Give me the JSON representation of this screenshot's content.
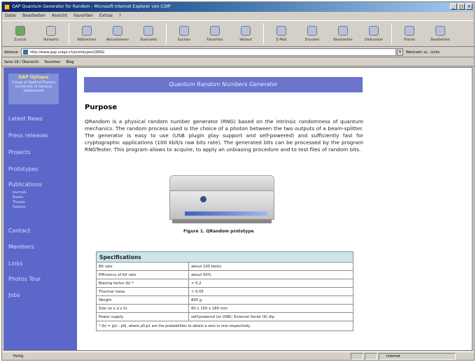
{
  "window": {
    "title": "QAP Quantum Generator for Random - Microsoft Internet Explorer von COIP"
  },
  "menu": [
    "Datei",
    "Bearbeiten",
    "Ansicht",
    "Favoriten",
    "Extras",
    "?"
  ],
  "toolbar": [
    {
      "label": "Zurück",
      "icon": "back-arrow-icon"
    },
    {
      "label": "Vorwärts",
      "icon": "forward-arrow-icon"
    },
    {
      "label": "Abbrechen",
      "icon": "stop-icon"
    },
    {
      "label": "Aktualisieren",
      "icon": "refresh-icon"
    },
    {
      "label": "Startseite",
      "icon": "home-icon"
    },
    {
      "label": "Suchen",
      "icon": "search-icon"
    },
    {
      "label": "Favoriten",
      "icon": "favorites-icon"
    },
    {
      "label": "Verlauf",
      "icon": "history-icon"
    },
    {
      "label": "E-Mail",
      "icon": "mail-icon"
    },
    {
      "label": "Drucken",
      "icon": "print-icon"
    },
    {
      "label": "Bearbeiten",
      "icon": "edit-icon"
    },
    {
      "label": "Diskussion",
      "icon": "discuss-icon"
    },
    {
      "label": "Planet",
      "icon": "planet-icon"
    },
    {
      "label": "Bearbeiten",
      "icon": "edit-icon"
    }
  ],
  "address": {
    "label": "Adresse",
    "url": "http://www.gap.unige.ch/prototypes/QRNG",
    "go": "Wechseln zu",
    "links": "Links"
  },
  "linksbar": [
    "Seite 18 / Übersicht",
    "Favoriten",
    "Blog"
  ],
  "nav": {
    "header_title": "GAP Optique",
    "header_lines": [
      "Group of Applied Physics",
      "University of Geneva",
      "Switzerland"
    ],
    "items": [
      "Latest News",
      "Press releases",
      "Projects",
      "Prototypes",
      "Publications",
      "Contact",
      "Members",
      "Links",
      "Photos Tour",
      "Jobs"
    ],
    "publication_subitems": [
      "Journals",
      "Books",
      "Theses",
      "Patents"
    ]
  },
  "page": {
    "banner": "Quantum Random Numbers Generator",
    "heading": "Purpose",
    "paragraph": "QRandom is a physical random number generator (RNG) based on the intrinsic randomness of quantum mechanics. The random process used is the choice of a photon between the two outputs of a beam-splitter. The generator is easy to use (USB plugin play support and self-powered) and sufficiently fast for cryptographic applications (100 kbit/s raw bits rate). The generated bits can be processed by the program RNGTester. This program allows to acquire, to apply an unbiasing procedure and to test files of random bits.",
    "figure_caption": "Figure 1. QRandom prototype"
  },
  "specs": {
    "title": "Specifications",
    "rows": [
      [
        "Bit rate",
        "about 100 kbit/s"
      ],
      [
        "Efficiency of bit rate",
        "about 50%"
      ],
      [
        "Biasing factor (b) *",
        "< 0.2"
      ],
      [
        "Thermal noise",
        "< 0.05"
      ],
      [
        "Weight",
        "800 g"
      ],
      [
        "Size (w x d x h)",
        "80 x 150 x 180 mm"
      ],
      [
        "Power supply",
        "self-powered (or USB); External Serial (9) dip"
      ]
    ],
    "note": "* (b) = |p1 - p0|, where p0,p1 are the probabilities to obtain a zero or one respectively."
  },
  "status": {
    "text": "Fertig",
    "zone": "Internet"
  },
  "colors": {
    "nav_bg": "#5b67c9",
    "banner_bg": "#6c74cc",
    "spec_header_bg": "#cfe4ea"
  }
}
